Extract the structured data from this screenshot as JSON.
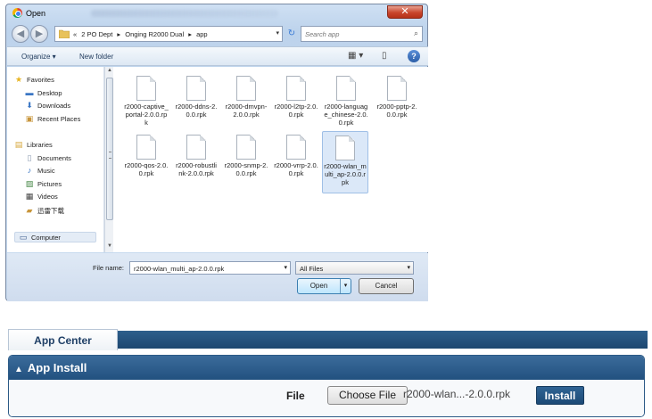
{
  "dialog": {
    "title": "Open",
    "close_glyph": "✕",
    "back_glyph": "◀",
    "forward_glyph": "▶",
    "breadcrumbs": [
      "«",
      "2 PO Dept",
      "▸",
      "Onging R2000 Dual",
      "▸",
      "app"
    ],
    "dropdown_glyph": "▾",
    "refresh_glyph": "↻",
    "search_placeholder": "Search app",
    "search_glyph": "⌕",
    "toolbar": {
      "organize": "Organize ▾",
      "new_folder": "New folder",
      "view_glyph": "▦ ▾",
      "pane_glyph": "▯",
      "help_glyph": "?"
    },
    "nav": {
      "favorites": "Favorites",
      "desktop": "Desktop",
      "downloads": "Downloads",
      "recent_places": "Recent Places",
      "libraries": "Libraries",
      "documents": "Documents",
      "music": "Music",
      "pictures": "Pictures",
      "videos": "Videos",
      "chinese_dl": "迅雷下载",
      "computer": "Computer"
    },
    "files": [
      "r2000-captive_portal-2.0.0.rpk",
      "r2000-ddns-2.0.0.rpk",
      "r2000-dmvpn-2.0.0.rpk",
      "r2000-l2tp-2.0.0.rpk",
      "r2000-language_chinese-2.0.0.rpk",
      "r2000-pptp-2.0.0.rpk",
      "r2000-qos-2.0.0.rpk",
      "r2000-robustlink-2.0.0.rpk",
      "r2000-snmp-2.0.0.rpk",
      "r2000-vrrp-2.0.0.rpk",
      "r2000-wlan_multi_ap-2.0.0.rpk"
    ],
    "file_name_label": "File name:",
    "file_name_value": "r2000-wlan_multi_ap-2.0.0.rpk",
    "file_type_value": "All Files",
    "open_button": "Open",
    "cancel_button": "Cancel"
  },
  "app_center": {
    "tab_label": "App Center",
    "section_title": "App Install",
    "caret_glyph": "▲",
    "file_label": "File",
    "choose_file_button": "Choose File",
    "chosen_file": "r2000-wlan...-2.0.0.rpk",
    "install_button": "Install"
  },
  "colors": {
    "accent": "#22517f",
    "dialog_frame": "#bdd3ec",
    "close_button": "#c9452c"
  }
}
